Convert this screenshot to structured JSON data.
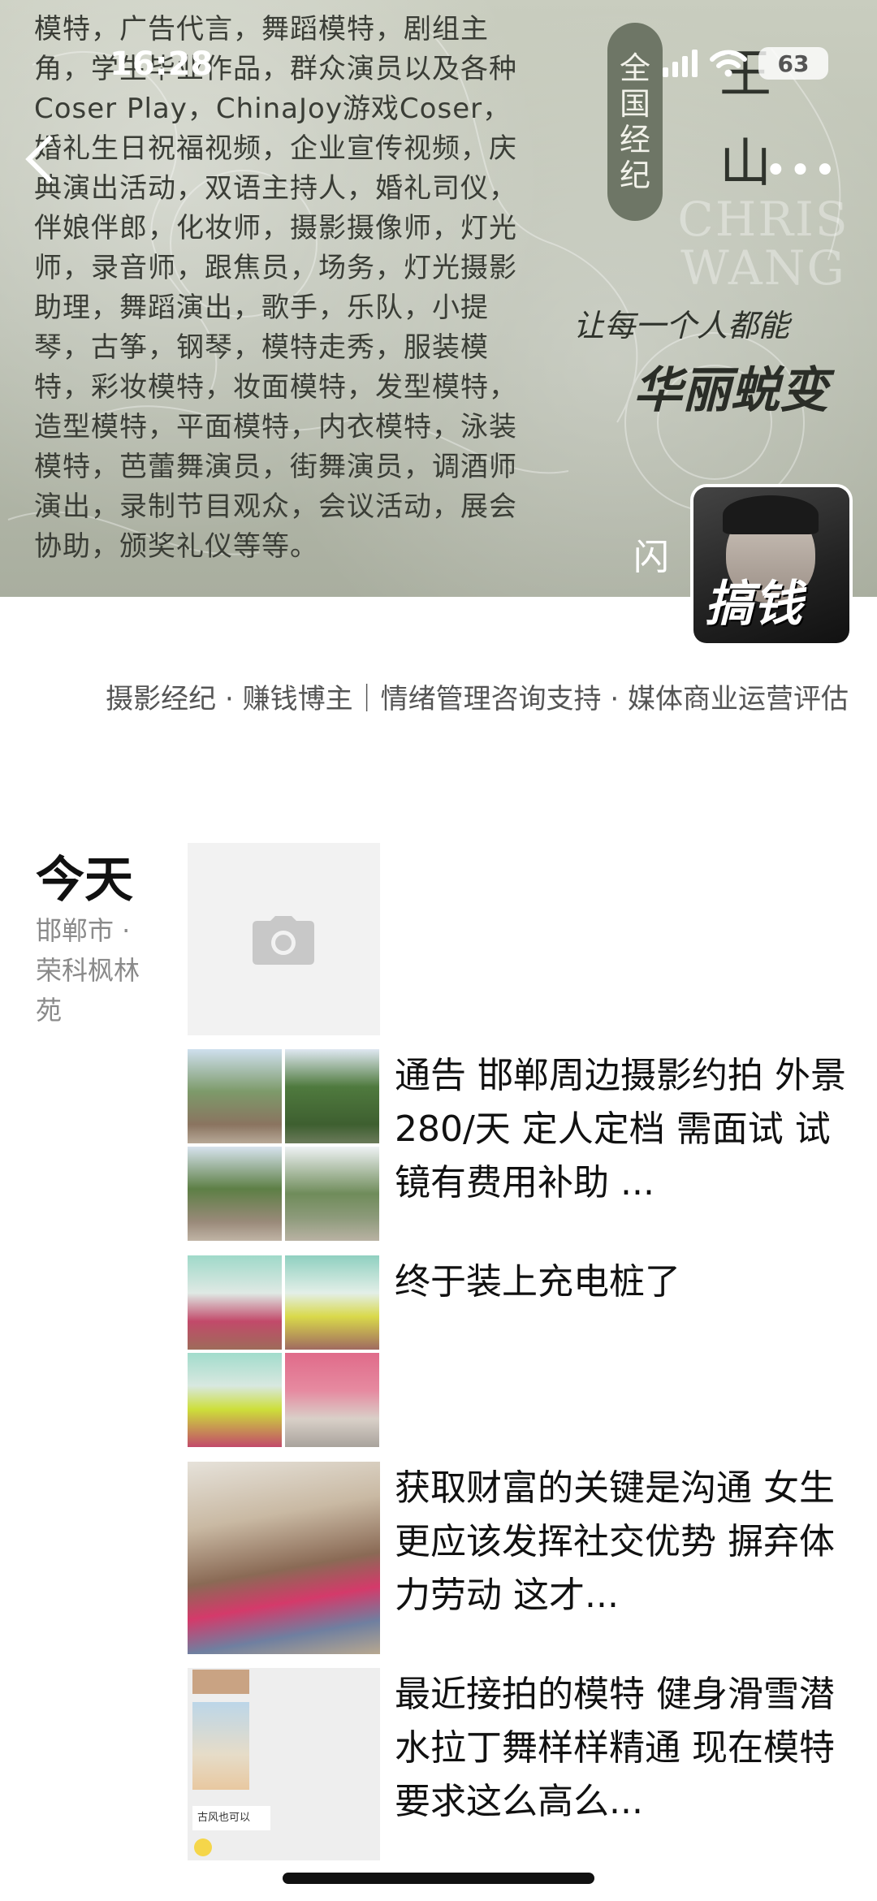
{
  "status": {
    "time": "16:28",
    "battery": "63"
  },
  "cover": {
    "text": "模特，广告代言，舞蹈模特，剧组主角，学生毕业作品，群众演员以及各种Coser Play，ChinaJoy游戏Coser，婚礼生日祝福视频，企业宣传视频，庆典演出活动，双语主持人，婚礼司仪，伴娘伴郎，化妆师，摄影摄像师，灯光师，录音师，跟焦员，场务，灯光摄影助理，舞蹈演出，歌手，乐队，小提琴，古筝，钢琴，模特走秀，服装模特，彩妆模特，妆面模特，发型模特，造型模特，平面模特，内衣模特，泳装模特，芭蕾舞演员，街舞演员，调酒师演出，录制节目观众，会议活动，展会协助，颁奖礼仪等等。",
    "pill_chars": [
      "全",
      "国",
      "经",
      "纪"
    ],
    "name_chars": [
      "王",
      "山"
    ],
    "brand_line1": "CHRIS",
    "brand_line2": "WANG",
    "slogan1": "让每一个人都能",
    "slogan2": "华丽蜕变",
    "flash": "闪"
  },
  "avatar": {
    "caption": "搞钱"
  },
  "bio": "摄影经纪 · 赚钱博主｜情绪管理咨询支持 · 媒体商业运营评估",
  "feed": {
    "day": "今天",
    "location": "邯郸市 · 荣科枫林苑",
    "posts": [
      {
        "text": "通告 邯郸周边摄影约拍 外景 280/天 定人定档 需面试 试镜有费用补助 ..."
      },
      {
        "text": "终于装上充电桩了"
      },
      {
        "text": "获取财富的关键是沟通 女生更应该发挥社交优势 摒弃体力劳动 这才..."
      },
      {
        "text": "最近接拍的模特 健身滑雪潜水拉丁舞样样精通 现在模特要求这么高么..."
      }
    ],
    "thumb4_caption": "古风也可以"
  },
  "colors": {
    "pill_bg": "#6e7666",
    "cover_bg": "#b9beb0"
  }
}
